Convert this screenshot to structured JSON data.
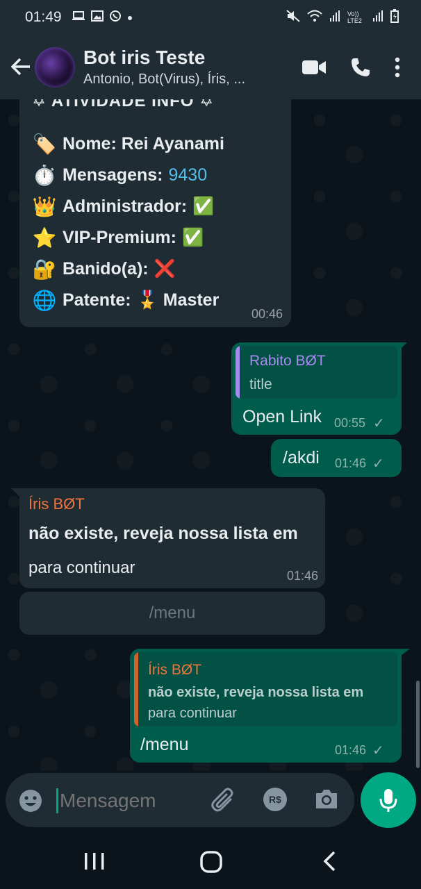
{
  "status": {
    "time": "01:49",
    "lte_label": "Vo)) LTE2"
  },
  "header": {
    "title": "Bot iris Teste",
    "subtitle": "Antonio, Bot(Virus), Íris, ..."
  },
  "info_card": {
    "cut_text": "✡ ATIVIDADE INFO ✡",
    "rows": [
      {
        "emoji": "🏷️",
        "label": "Nome: Rei Ayanami",
        "value": ""
      },
      {
        "emoji": "⏱️",
        "label": "Mensagens:",
        "value": "9430"
      },
      {
        "emoji": "👑",
        "label": "Administrador:",
        "value": "✅"
      },
      {
        "emoji": "⭐",
        "label": "VIP-Premium:",
        "value": "✅"
      },
      {
        "emoji": "🔐",
        "label": "Banido(a):",
        "value": "❌"
      },
      {
        "emoji": "🌐",
        "label": "Patente:",
        "value": "🎖️ Master"
      }
    ],
    "time": "00:46"
  },
  "msg_rabito": {
    "quote_sender": "Rabito BØT",
    "quote_text": "title",
    "body": "Open Link",
    "time": "00:55",
    "check": "✓"
  },
  "msg_akdi": {
    "body": "/akdi",
    "time": "01:46",
    "check": "✓"
  },
  "msg_iris": {
    "sender": "Íris BØT",
    "bold_text": "não existe, reveja nossa lista em",
    "text": "para continuar",
    "time": "01:46",
    "button_label": "/menu"
  },
  "msg_reply": {
    "quote_sender": "Íris BØT",
    "quote_bold": "não existe, reveja nossa lista em",
    "quote_text": "para continuar",
    "body": "/menu",
    "time": "01:46",
    "check": "✓"
  },
  "composer": {
    "placeholder": "Mensagem",
    "currency": "R$"
  },
  "colors": {
    "accent": "#00a884",
    "bubble_out": "#005c4b",
    "bubble_in": "#202c33",
    "sender_purple": "#a78bf0",
    "sender_orange": "#f0743e"
  }
}
